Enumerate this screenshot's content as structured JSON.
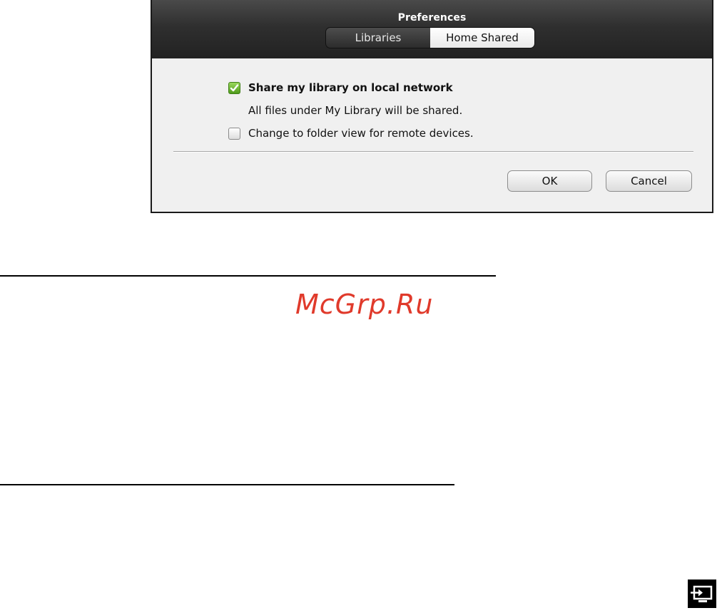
{
  "dialog": {
    "title": "Preferences",
    "tabs": [
      {
        "label": "Libraries",
        "active": false
      },
      {
        "label": "Home Shared",
        "active": true
      }
    ],
    "options": {
      "share_library": {
        "label": "Share my library on local network",
        "checked": true
      },
      "share_description": "All files under My Library will be shared.",
      "folder_view": {
        "label": "Change to folder view for remote devices.",
        "checked": false
      }
    },
    "buttons": {
      "ok": "OK",
      "cancel": "Cancel"
    }
  },
  "page": {
    "watermark": "McGrp.Ru",
    "icons": [
      "checkbox-checked-icon",
      "checkbox-unchecked-icon",
      "external-display-icon"
    ]
  },
  "colors": {
    "header_dark": "#2f2f2f",
    "checkbox_green": "#6cb52d",
    "watermark_red": "#e03a2b"
  }
}
